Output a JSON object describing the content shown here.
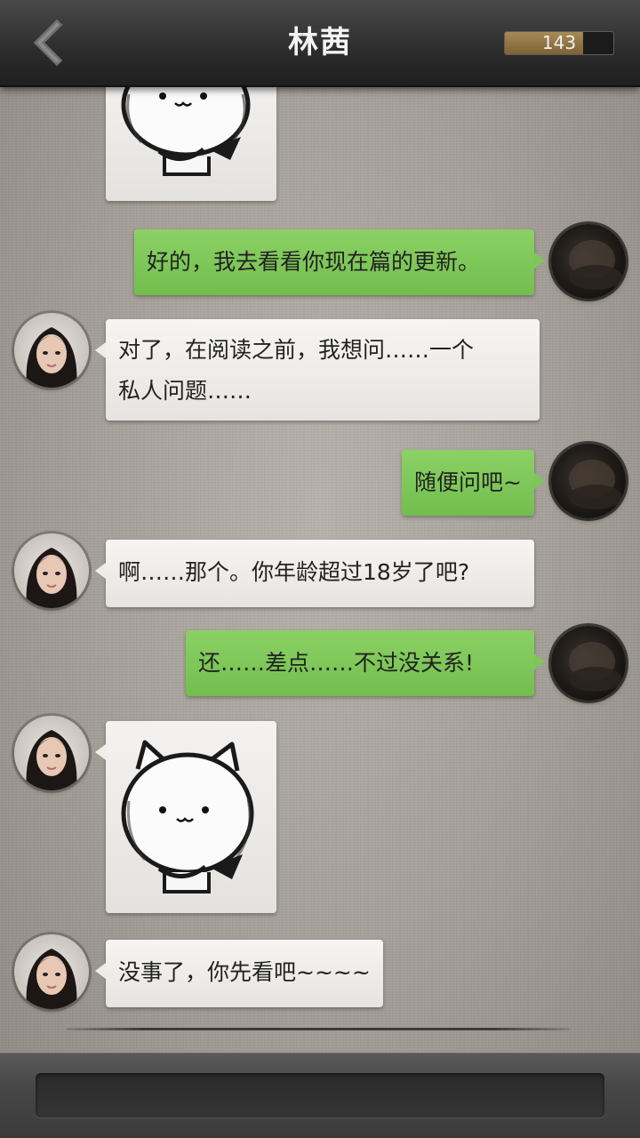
{
  "header": {
    "title": "林茜",
    "counter_value": "143",
    "back_icon": "chevron-left-icon"
  },
  "messages": [
    {
      "sender": "contact",
      "type": "sticker",
      "sticker": "cat-arms-crossed-sticker",
      "partial": true
    },
    {
      "sender": "me",
      "type": "text",
      "lines": [
        "好的，我去看看你现在篇的更新。"
      ]
    },
    {
      "sender": "contact",
      "type": "text",
      "lines": [
        "对了，在阅读之前，我想问……一个",
        "私人问题……"
      ]
    },
    {
      "sender": "me",
      "type": "text",
      "lines": [
        "随便问吧~"
      ]
    },
    {
      "sender": "contact",
      "type": "text",
      "lines": [
        "啊……那个。你年龄超过18岁了吧?"
      ]
    },
    {
      "sender": "me",
      "type": "text",
      "lines": [
        "还……差点……不过没关系!"
      ]
    },
    {
      "sender": "contact",
      "type": "sticker",
      "sticker": "cat-arms-crossed-sticker"
    },
    {
      "sender": "contact",
      "type": "text",
      "lines": [
        "没事了，你先看吧~~~~"
      ]
    }
  ],
  "input": {
    "value": "",
    "placeholder": ""
  },
  "colors": {
    "my_bubble": "#7dc658",
    "contact_bubble": "#eeecea",
    "header": "#2c2c2c",
    "counter_fill": "#a88a56"
  }
}
